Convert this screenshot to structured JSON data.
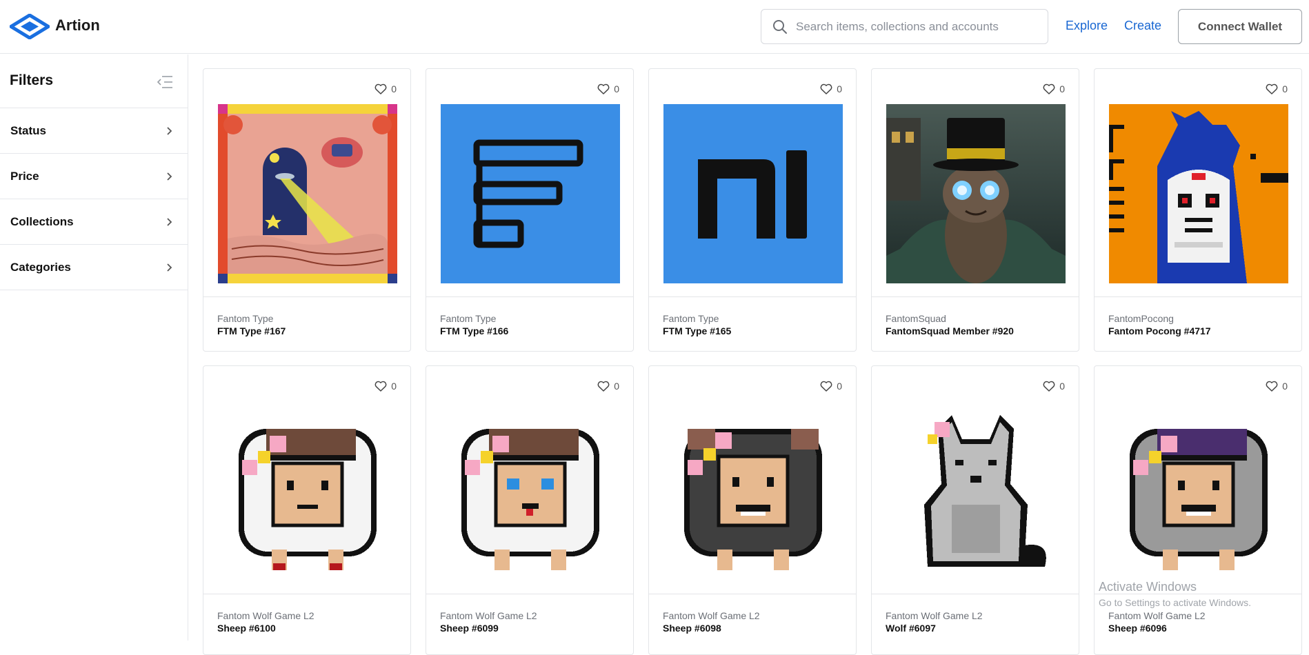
{
  "header": {
    "brand": "Artion",
    "search_placeholder": "Search items, collections and accounts",
    "nav_explore": "Explore",
    "nav_create": "Create",
    "connect_wallet": "Connect Wallet"
  },
  "sidebar": {
    "title": "Filters",
    "items": [
      {
        "label": "Status"
      },
      {
        "label": "Price"
      },
      {
        "label": "Collections"
      },
      {
        "label": "Categories"
      }
    ]
  },
  "cards": [
    {
      "collection": "Fantom Type",
      "name": "FTM Type #167",
      "likes": "0",
      "art": "arch-ufo"
    },
    {
      "collection": "Fantom Type",
      "name": "FTM Type #166",
      "likes": "0",
      "art": "glyph-f"
    },
    {
      "collection": "Fantom Type",
      "name": "FTM Type #165",
      "likes": "0",
      "art": "glyph-n"
    },
    {
      "collection": "FantomSquad",
      "name": "FantomSquad Member #920",
      "likes": "0",
      "art": "bat-tophat"
    },
    {
      "collection": "FantomPocong",
      "name": "Fantom Pocong #4717",
      "likes": "0",
      "art": "pocong-prison"
    },
    {
      "collection": "Fantom Wolf Game L2",
      "name": "Sheep #6100",
      "likes": "0",
      "art": "sheep-brown-hat"
    },
    {
      "collection": "Fantom Wolf Game L2",
      "name": "Sheep #6099",
      "likes": "0",
      "art": "sheep-blue-eyes"
    },
    {
      "collection": "Fantom Wolf Game L2",
      "name": "Sheep #6098",
      "likes": "0",
      "art": "sheep-black"
    },
    {
      "collection": "Fantom Wolf Game L2",
      "name": "Wolf #6097",
      "likes": "0",
      "art": "wolf-grey"
    },
    {
      "collection": "Fantom Wolf Game L2",
      "name": "Sheep #6096",
      "likes": "0",
      "art": "sheep-purple-hat"
    }
  ],
  "watermark": {
    "line1": "Activate Windows",
    "line2": "Go to Settings to activate Windows."
  },
  "colors": {
    "accent": "#1967d2",
    "border": "#e3e5e8",
    "glyph_blue": "#3a8ee6",
    "pocong_orange": "#f08a00"
  }
}
